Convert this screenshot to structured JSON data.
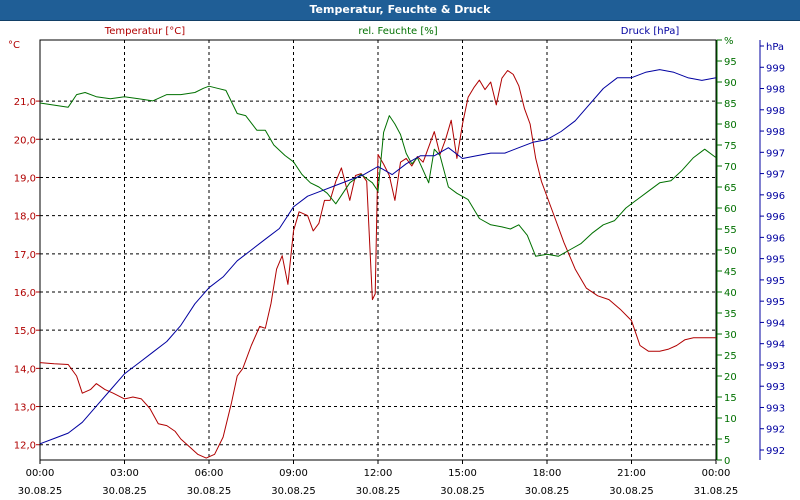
{
  "window": {
    "title": "Temperatur, Feuchte & Druck"
  },
  "chart_data": {
    "type": "line",
    "title": "Temperatur, Feuchte & Druck",
    "x_unit": "hours since 30.08.25 00:00",
    "xlim": [
      0,
      24
    ],
    "x_ticks": [
      {
        "h": 0,
        "time": "00:00",
        "date": "30.08.25"
      },
      {
        "h": 3,
        "time": "03:00",
        "date": "30.08.25"
      },
      {
        "h": 6,
        "time": "06:00",
        "date": "30.08.25"
      },
      {
        "h": 9,
        "time": "09:00",
        "date": "30.08.25"
      },
      {
        "h": 12,
        "time": "12:00",
        "date": "30.08.25"
      },
      {
        "h": 15,
        "time": "15:00",
        "date": "30.08.25"
      },
      {
        "h": 18,
        "time": "18:00",
        "date": "30.08.25"
      },
      {
        "h": 21,
        "time": "21:00",
        "date": "30.08.25"
      },
      {
        "h": 24,
        "time": "00:00",
        "date": "31.08.25"
      }
    ],
    "grid": true,
    "axes": {
      "temperature": {
        "label": "Temperatur [°C]",
        "unit": "°C",
        "color": "#b00000",
        "ylim": [
          11.6,
          22.6
        ],
        "ticks": [
          12.0,
          13.0,
          14.0,
          15.0,
          16.0,
          17.0,
          18.0,
          19.0,
          20.0,
          21.0
        ],
        "tick_labels": [
          "12,0",
          "13,0",
          "14,0",
          "15,0",
          "16,0",
          "17,0",
          "18,0",
          "19,0",
          "20,0",
          "21,0"
        ]
      },
      "humidity": {
        "label": "rel. Feuchte [%]",
        "unit": "%",
        "color": "#007000",
        "ylim": [
          0,
          100
        ],
        "ticks": [
          0,
          5,
          10,
          15,
          20,
          25,
          30,
          35,
          40,
          45,
          50,
          55,
          60,
          65,
          70,
          75,
          80,
          85,
          90,
          95,
          100
        ],
        "tick_labels": [
          "0",
          "5",
          "10",
          "15",
          "20",
          "25",
          "30",
          "35",
          "40",
          "45",
          "50",
          "55",
          "60",
          "65",
          "70",
          "75",
          "80",
          "85",
          "90",
          "95",
          "%"
        ]
      },
      "pressure": {
        "label": "Druck [hPa]",
        "unit": "hPa",
        "color": "#0000a0",
        "ylim": [
          991.7,
          999.5
        ],
        "tick_labels": [
          "992",
          "992",
          "993",
          "993",
          "993",
          "994",
          "994",
          "995",
          "995",
          "995",
          "996",
          "996",
          "996",
          "997",
          "997",
          "998",
          "998",
          "998",
          "999",
          "hPa"
        ]
      }
    },
    "series": [
      {
        "name": "Temperatur [°C]",
        "axis": "temperature",
        "color": "#b00000",
        "x": [
          0,
          0.5,
          1,
          1.3,
          1.5,
          1.8,
          2,
          2.3,
          2.6,
          3,
          3.3,
          3.6,
          3.9,
          4.2,
          4.5,
          4.8,
          5,
          5.3,
          5.6,
          5.9,
          6.2,
          6.5,
          6.8,
          7,
          7.2,
          7.5,
          7.8,
          8,
          8.2,
          8.4,
          8.6,
          8.8,
          9,
          9.2,
          9.5,
          9.7,
          9.9,
          10.1,
          10.3,
          10.5,
          10.7,
          11,
          11.2,
          11.4,
          11.6,
          11.8,
          11.9,
          12,
          12.2,
          12.4,
          12.6,
          12.8,
          13,
          13.2,
          13.4,
          13.6,
          13.8,
          14,
          14.2,
          14.4,
          14.6,
          14.8,
          15,
          15.2,
          15.4,
          15.6,
          15.8,
          16,
          16.2,
          16.4,
          16.6,
          16.8,
          17,
          17.2,
          17.4,
          17.6,
          17.8,
          18,
          18.3,
          18.6,
          19,
          19.4,
          19.8,
          20.2,
          20.6,
          21,
          21.3,
          21.6,
          22,
          22.3,
          22.6,
          22.9,
          23.2,
          23.5,
          23.8,
          24
        ],
        "y": [
          14.15,
          14.12,
          14.1,
          13.8,
          13.35,
          13.45,
          13.6,
          13.45,
          13.35,
          13.2,
          13.25,
          13.2,
          12.95,
          12.55,
          12.5,
          12.35,
          12.15,
          11.95,
          11.75,
          11.65,
          11.75,
          12.2,
          13.1,
          13.8,
          14.0,
          14.6,
          15.1,
          15.05,
          15.7,
          16.6,
          16.95,
          16.2,
          17.6,
          18.1,
          18.0,
          17.6,
          17.8,
          18.4,
          18.4,
          18.9,
          19.25,
          18.4,
          19.05,
          19.1,
          18.9,
          15.8,
          15.95,
          19.6,
          19.35,
          19.05,
          18.4,
          19.4,
          19.5,
          19.3,
          19.55,
          19.4,
          19.8,
          20.2,
          19.6,
          20.0,
          20.5,
          19.5,
          20.4,
          21.1,
          21.35,
          21.55,
          21.3,
          21.5,
          20.9,
          21.6,
          21.8,
          21.7,
          21.4,
          20.8,
          20.4,
          19.5,
          18.9,
          18.5,
          17.9,
          17.3,
          16.6,
          16.1,
          15.9,
          15.8,
          15.55,
          15.25,
          14.6,
          14.45,
          14.45,
          14.5,
          14.6,
          14.75,
          14.8,
          14.8,
          14.8,
          14.8
        ],
        "__fix": null
      },
      {
        "name": "rel. Feuchte [%]",
        "axis": "humidity",
        "color": "#007000",
        "x": [
          0,
          0.5,
          1,
          1.3,
          1.6,
          2,
          2.5,
          3,
          3.5,
          4,
          4.5,
          5,
          5.5,
          5.8,
          6,
          6.3,
          6.6,
          7,
          7.3,
          7.7,
          8,
          8.3,
          8.7,
          9,
          9.3,
          9.6,
          9.9,
          10.2,
          10.5,
          10.8,
          11,
          11.2,
          11.4,
          11.6,
          11.8,
          12,
          12.2,
          12.4,
          12.6,
          12.8,
          13,
          13.2,
          13.4,
          13.6,
          13.8,
          14,
          14.2,
          14.5,
          14.8,
          15.2,
          15.6,
          16,
          16.4,
          16.7,
          17,
          17.3,
          17.6,
          18,
          18.4,
          18.8,
          19.2,
          19.6,
          20,
          20.4,
          20.8,
          21.2,
          21.6,
          22,
          22.4,
          22.8,
          23.2,
          23.6,
          24
        ],
        "y": [
          85,
          84.5,
          84,
          87,
          87.5,
          86.5,
          86,
          86.5,
          86,
          85.5,
          87,
          87,
          87.5,
          88.5,
          89,
          88.5,
          88,
          82.5,
          82,
          78.5,
          78.5,
          75,
          72.5,
          71,
          68,
          66,
          65,
          63.5,
          61,
          64,
          66,
          67,
          68,
          67,
          66,
          64,
          78,
          82,
          80,
          77.5,
          73,
          70.5,
          72,
          69,
          66,
          74,
          72.5,
          65,
          63.5,
          62,
          57.5,
          56,
          55.5,
          55,
          56,
          53.5,
          48.5,
          49,
          48.5,
          50,
          51.5,
          54,
          56,
          57,
          60,
          62,
          64,
          66,
          66.5,
          69,
          72,
          74,
          72
        ],
        "__fix": null
      },
      {
        "name": "Druck [hPa]",
        "axis": "pressure",
        "color": "#0000a0",
        "x": [
          0,
          0.5,
          1,
          1.5,
          2,
          2.5,
          3,
          3.5,
          4,
          4.5,
          5,
          5.5,
          6,
          6.5,
          7,
          7.5,
          8,
          8.5,
          9,
          9.5,
          10,
          10.5,
          11,
          11.5,
          12,
          12.5,
          13,
          13.5,
          14,
          14.5,
          15,
          15.5,
          16,
          16.5,
          17,
          17.5,
          18,
          18.5,
          19,
          19.5,
          20,
          20.5,
          21,
          21.5,
          22,
          22.5,
          23,
          23.5,
          24
        ],
        "y": [
          992.0,
          992.1,
          992.2,
          992.4,
          992.7,
          993.0,
          993.3,
          993.5,
          993.7,
          993.9,
          994.2,
          994.6,
          994.9,
          995.1,
          995.4,
          995.6,
          995.8,
          996.0,
          996.4,
          996.6,
          996.7,
          996.8,
          996.9,
          997.0,
          997.15,
          997.0,
          997.2,
          997.35,
          997.35,
          997.5,
          997.3,
          997.35,
          997.4,
          997.4,
          997.5,
          997.6,
          997.65,
          997.8,
          998.0,
          998.3,
          998.6,
          998.8,
          998.8,
          998.9,
          998.95,
          998.9,
          998.8,
          998.75,
          998.8
        ],
        "__fix": null
      }
    ]
  }
}
